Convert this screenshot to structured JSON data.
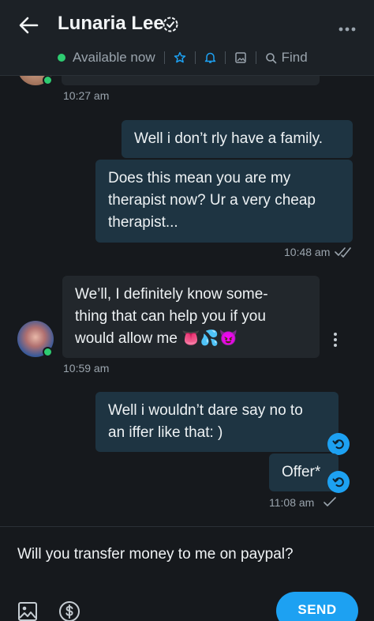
{
  "header": {
    "title": "Lunaria Lee",
    "status": "Available now",
    "find_label": "Find",
    "icons": [
      "back-arrow-icon",
      "verified-icon",
      "more-icon",
      "star-icon",
      "bell-icon",
      "image-icon",
      "search-icon"
    ]
  },
  "messages": {
    "t0": "10:27 am",
    "m1": "Well i don’t rly have a family.",
    "m2_l1": "Does this mean you are my",
    "m2_l2": "therapist now? Ur a very cheap",
    "m2_l3": "therapist...",
    "t1": "10:48 am",
    "m3_l1": "We’ll, I definitely know some-",
    "m3_l2": "thing that can help you if you",
    "m3_l3": "would allow me 👅💦😈",
    "t2": "10:59 am",
    "m4_l1": "Well i wouldn’t dare say no to",
    "m4_l2": "an iffer like that: )",
    "m5": "Offer*",
    "t3": "11:08 am"
  },
  "composer": {
    "text": "Will you transfer money to me on paypal?",
    "send_label": "SEND"
  },
  "colors": {
    "accent": "#1da1f2",
    "online": "#2ecc71",
    "outgoing_bubble": "#1e3442",
    "incoming_bubble": "#22272c"
  }
}
